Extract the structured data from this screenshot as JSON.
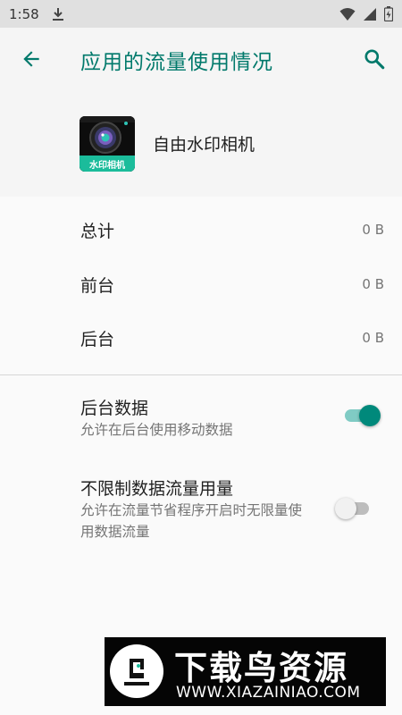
{
  "status_bar": {
    "time": "1:58",
    "icons": [
      "download-icon",
      "wifi-icon",
      "signal-icon",
      "battery-icon"
    ]
  },
  "app_bar": {
    "title": "应用的流量使用情况",
    "back_icon": "arrow-back-icon",
    "search_icon": "search-icon",
    "accent_color": "#00796b"
  },
  "app_header": {
    "app_name": "自由水印相机",
    "icon_text": "水印相机"
  },
  "usage": [
    {
      "label": "总计",
      "value": "0 B"
    },
    {
      "label": "前台",
      "value": "0 B"
    },
    {
      "label": "后台",
      "value": "0 B"
    }
  ],
  "settings": [
    {
      "title": "后台数据",
      "subtitle": "允许在后台使用移动数据",
      "enabled": true
    },
    {
      "title": "不限制数据流量用量",
      "subtitle": "允许在流量节省程序开启时无限量使用数据流量",
      "enabled": false
    }
  ],
  "watermark": {
    "title": "下载鸟资源",
    "url": "WWW.XIAZAINIAO.COM"
  }
}
